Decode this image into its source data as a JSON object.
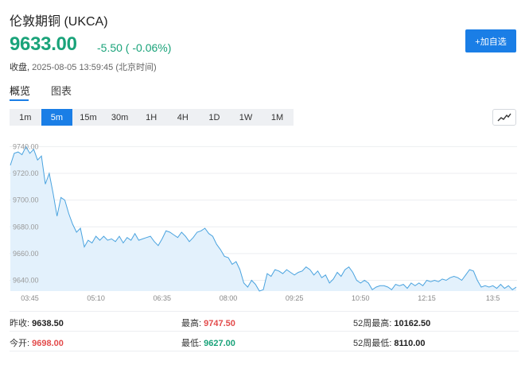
{
  "header": {
    "title": "伦敦期铜 (UKCA)",
    "price": "9633.00",
    "change": "-5.50 ( -0.06%)",
    "close_label": "收盘,",
    "close_time": " 2025-08-05 13:59:45 (北京时间)",
    "follow_label": "+加自选"
  },
  "tabs": [
    {
      "label": "概览",
      "active": true
    },
    {
      "label": "图表",
      "active": false
    }
  ],
  "ranges": [
    {
      "label": "1m",
      "active": false
    },
    {
      "label": "5m",
      "active": true
    },
    {
      "label": "15m",
      "active": false
    },
    {
      "label": "30m",
      "active": false
    },
    {
      "label": "1H",
      "active": false
    },
    {
      "label": "4H",
      "active": false
    },
    {
      "label": "1D",
      "active": false
    },
    {
      "label": "1W",
      "active": false
    },
    {
      "label": "1M",
      "active": false
    }
  ],
  "chart_toggle_icon": "line-chart-icon",
  "chart_data": {
    "type": "area",
    "title": "",
    "xlabel": "",
    "ylabel": "",
    "ylim": [
      9632,
      9745
    ],
    "yticks": [
      "9740.00",
      "9720.00",
      "9700.00",
      "9680.00",
      "9660.00",
      "9640.00"
    ],
    "ytick_values": [
      9740,
      9720,
      9700,
      9680,
      9660,
      9640
    ],
    "xticks": [
      "03:45",
      "05:10",
      "06:35",
      "08:00",
      "09:25",
      "10:50",
      "12:15",
      "13:5"
    ],
    "xtick_index": [
      5,
      22,
      39,
      56,
      73,
      90,
      107,
      124
    ],
    "grid": true,
    "line_color": "#4aa3df",
    "fill_color": "#e3f1fc",
    "values": [
      9726,
      9735,
      9736,
      9734,
      9740,
      9735,
      9738,
      9730,
      9733,
      9712,
      9720,
      9705,
      9688,
      9702,
      9700,
      9690,
      9682,
      9676,
      9679,
      9665,
      9670,
      9668,
      9673,
      9670,
      9673,
      9670,
      9671,
      9669,
      9673,
      9668,
      9672,
      9670,
      9675,
      9670,
      9671,
      9672,
      9673,
      9669,
      9666,
      9671,
      9677,
      9676,
      9674,
      9672,
      9676,
      9673,
      9669,
      9672,
      9676,
      9677,
      9679,
      9675,
      9673,
      9667,
      9663,
      9658,
      9657,
      9652,
      9654,
      9648,
      9638,
      9635,
      9640,
      9637,
      9632,
      9633,
      9645,
      9643,
      9648,
      9647,
      9645,
      9648,
      9646,
      9644,
      9646,
      9647,
      9650,
      9648,
      9644,
      9647,
      9642,
      9644,
      9638,
      9641,
      9646,
      9643,
      9648,
      9650,
      9646,
      9640,
      9638,
      9640,
      9638,
      9633,
      9635,
      9636,
      9636,
      9635,
      9633,
      9637,
      9636,
      9637,
      9634,
      9638,
      9636,
      9638,
      9636,
      9640,
      9639,
      9640,
      9639,
      9641,
      9640,
      9642,
      9643,
      9642,
      9640,
      9644,
      9648,
      9647,
      9640,
      9635,
      9636,
      9635,
      9636,
      9634,
      9637,
      9634,
      9636,
      9633,
      9635
    ]
  },
  "stats": [
    {
      "label": "昨收:",
      "value": "9638.50",
      "tone": "normal"
    },
    {
      "label": "最高:",
      "value": "9747.50",
      "tone": "red"
    },
    {
      "label": "52周最高:",
      "value": "10162.50",
      "tone": "normal"
    },
    {
      "label": "今开:",
      "value": "9698.00",
      "tone": "red"
    },
    {
      "label": "最低:",
      "value": "9627.00",
      "tone": "green"
    },
    {
      "label": "52周最低:",
      "value": "8110.00",
      "tone": "normal"
    }
  ]
}
